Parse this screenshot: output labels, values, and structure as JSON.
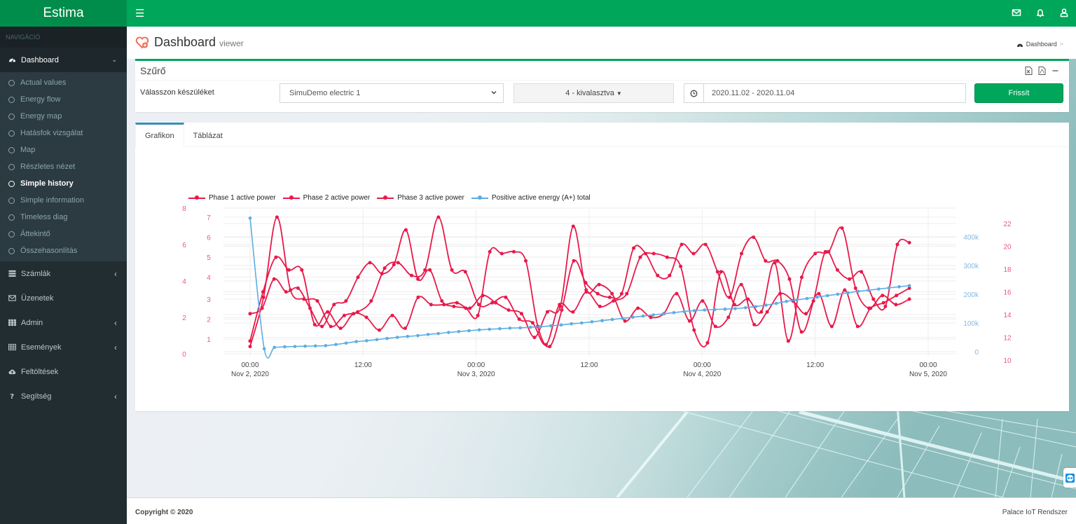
{
  "app": {
    "brand": "Estima",
    "menu_toggle_icon": "hamburger-icon",
    "top_icons": [
      "envelope-icon",
      "bell-icon",
      "user-icon"
    ]
  },
  "sidebar": {
    "header": "NAVIGÁCIÓ",
    "dashboard": {
      "label": "Dashboard",
      "icon": "dashboard-icon",
      "chevron": "chevron-down-icon"
    },
    "submenu": [
      {
        "label": "Actual values"
      },
      {
        "label": "Energy flow"
      },
      {
        "label": "Energy map"
      },
      {
        "label": "Hatásfok vizsgálat"
      },
      {
        "label": "Map"
      },
      {
        "label": "Részletes nézet"
      },
      {
        "label": "Simple history",
        "current": true
      },
      {
        "label": "Simple information"
      },
      {
        "label": "Timeless diag"
      },
      {
        "label": "Áttekintő"
      },
      {
        "label": "Összehasonlítás"
      }
    ],
    "items": [
      {
        "label": "Számlák",
        "icon": "list-icon",
        "has_chevron": true
      },
      {
        "label": "Üzenetek",
        "icon": "envelope-icon",
        "has_chevron": false
      },
      {
        "label": "Admin",
        "icon": "grid-icon",
        "has_chevron": true
      },
      {
        "label": "Események",
        "icon": "table-icon",
        "has_chevron": true
      },
      {
        "label": "Feltöltések",
        "icon": "cloud-upload-icon",
        "has_chevron": false
      },
      {
        "label": "Segítség",
        "icon": "question-icon",
        "has_chevron": true
      }
    ],
    "chevron_left": "‹",
    "chevron_down": "⌄"
  },
  "header": {
    "title": "Dashboard",
    "subtitle": "viewer",
    "breadcrumb": {
      "label": "Dashboard",
      "separator": ">"
    }
  },
  "filter": {
    "title": "Szűrő",
    "tools": [
      "excel-export-icon",
      "pdf-export-icon",
      "collapse-icon"
    ],
    "device_label": "Válasszon készüléket",
    "device_value": "SimuDemo electric 1",
    "multi_select_value": "4 - kivalasztva",
    "date_range": "2020.11.02 - 2020.11.04",
    "refresh_label": "Frissít"
  },
  "tabs": [
    {
      "label": "Grafikon",
      "active": true
    },
    {
      "label": "Táblázat",
      "active": false
    }
  ],
  "footer": {
    "copyright": "Copyright © 2020",
    "right": "Palace IoT Rendszer"
  },
  "colors": {
    "brand_green": "#00a65a",
    "brand_dark": "#008d4c",
    "sidebar_bg": "#222d32",
    "phase_red": "#e8194a",
    "energy_blue": "#5dade2",
    "tab_active": "#3c8dbc"
  },
  "chart_data": {
    "type": "line",
    "title": "",
    "legend": [
      "Phase 1 active power",
      "Phase 2 active power",
      "Phase 3 active power",
      "Positive active energy (A+) total"
    ],
    "legend_position": "top-left",
    "grid": true,
    "x": {
      "type": "datetime",
      "start": "2020-11-02T00:00",
      "end": "2020-11-05T00:00",
      "step_hours": 1.5,
      "ticks": [
        {
          "label": "00:00",
          "sub": "Nov 2, 2020",
          "hour": 0
        },
        {
          "label": "12:00",
          "sub": "",
          "hour": 12
        },
        {
          "label": "00:00",
          "sub": "Nov 3, 2020",
          "hour": 24
        },
        {
          "label": "12:00",
          "sub": "",
          "hour": 36
        },
        {
          "label": "00:00",
          "sub": "Nov 4, 2020",
          "hour": 48
        },
        {
          "label": "12:00",
          "sub": "",
          "hour": 60
        },
        {
          "label": "00:00",
          "sub": "Nov 5, 2020",
          "hour": 72
        }
      ]
    },
    "y_axes": [
      {
        "id": "left-outer",
        "ticks": [
          0,
          2,
          4,
          6,
          8
        ],
        "range": [
          0,
          8
        ],
        "color": "#e8194a"
      },
      {
        "id": "left-inner",
        "ticks": [
          1,
          2,
          3,
          4,
          5,
          6,
          7
        ],
        "range": [
          0.5,
          7.5
        ],
        "color": "#e8194a"
      },
      {
        "id": "right-inner",
        "ticks": [
          "0",
          "100k",
          "200k",
          "300k",
          "400k"
        ],
        "range": [
          0,
          400000
        ],
        "color": "#85b8e0"
      },
      {
        "id": "right-outer",
        "ticks": [
          10,
          12,
          14,
          16,
          18,
          20,
          22
        ],
        "range": [
          10,
          22
        ],
        "color": "#e8194a"
      }
    ],
    "series": [
      {
        "name": "Phase 1 active power",
        "axis": "left-outer",
        "color": "#e8194a",
        "values": [
          0.4,
          3.1,
          7.5,
          3.5,
          3.0,
          2.9,
          1.5,
          2.1,
          2.3,
          2.9,
          4.7,
          5.0,
          4.3,
          4.6,
          7.5,
          4.6,
          4.5,
          2.7,
          2.8,
          3.1,
          1.9,
          1.7,
          0.5,
          2.7,
          2.3,
          3.4,
          2.6,
          2.9,
          3.3,
          5.3,
          5.5,
          5.3,
          4.8,
          1.3,
          0.6,
          4.5,
          2.7,
          3.0,
          2.3,
          5.0,
          0.7,
          4.2,
          5.5,
          5.6,
          6.9,
          3.6,
          2.5,
          3.2,
          2.7,
          3.0
        ]
      },
      {
        "name": "Phase 2 active power",
        "axis": "left-outer",
        "color": "#e8194a",
        "values": [
          0.7,
          3.4,
          5.3,
          4.6,
          4.6,
          1.6,
          2.3,
          1.4,
          2.2,
          2.0,
          1.3,
          2.1,
          1.4,
          3.1,
          2.7,
          2.7,
          2.8,
          2.5,
          3.2,
          2.8,
          2.4,
          2.2,
          0.9,
          2.3,
          2.6,
          7.0,
          3.5,
          3.8,
          3.3,
          1.8,
          2.5,
          2.0,
          2.2,
          3.3,
          1.8,
          2.9,
          1.5,
          2.0,
          3.8,
          1.6,
          2.3,
          3.3,
          2.9,
          2.2,
          3.3,
          1.5,
          3.5,
          1.5,
          2.5,
          2.8,
          3.2,
          3.6
        ]
      },
      {
        "name": "Phase 3 active power",
        "axis": "left-outer",
        "color": "#e8194a",
        "values": [
          2.2,
          2.5,
          4.1,
          3.4,
          3.6,
          2.5,
          1.5,
          2.7,
          2.9,
          4.2,
          5.0,
          4.4,
          4.9,
          6.8,
          4.1,
          4.6,
          2.9,
          2.6,
          2.5,
          2.1,
          5.6,
          5.5,
          5.6,
          5.1,
          1.5,
          0.4,
          2.4,
          5.1,
          3.9,
          3.3,
          3.1,
          3.3,
          5.8,
          5.5,
          4.3,
          4.3,
          6.0,
          5.5,
          6.0,
          4.5,
          3.1,
          5.5,
          6.4,
          5.1,
          5.1,
          4.1,
          1.2,
          2.9,
          5.6,
          4.6,
          4.1,
          4.5,
          3.0,
          2.6,
          6.0,
          6.1
        ]
      },
      {
        "name": "Positive active energy (A+) total",
        "axis": "right-inner",
        "color": "#5dade2",
        "values": [
          465000,
          10000,
          15000,
          17000,
          18000,
          19000,
          20000,
          21000,
          25000,
          30000,
          35000,
          38000,
          42000,
          46000,
          50000,
          53000,
          56000,
          60000,
          63000,
          67000,
          70000,
          73000,
          76000,
          78000,
          80000,
          82000,
          83000,
          85000,
          87000,
          90000,
          93000,
          97000,
          100000,
          104000,
          108000,
          112000,
          116000,
          120000,
          124000,
          128000,
          132000,
          136000,
          140000,
          143000,
          145000,
          147000,
          148000,
          150000,
          153000,
          157000,
          162000,
          168000,
          175000,
          180000,
          185000,
          190000,
          195000,
          200000,
          205000,
          210000,
          214000,
          218000,
          222000,
          226000,
          230000
        ]
      }
    ]
  }
}
